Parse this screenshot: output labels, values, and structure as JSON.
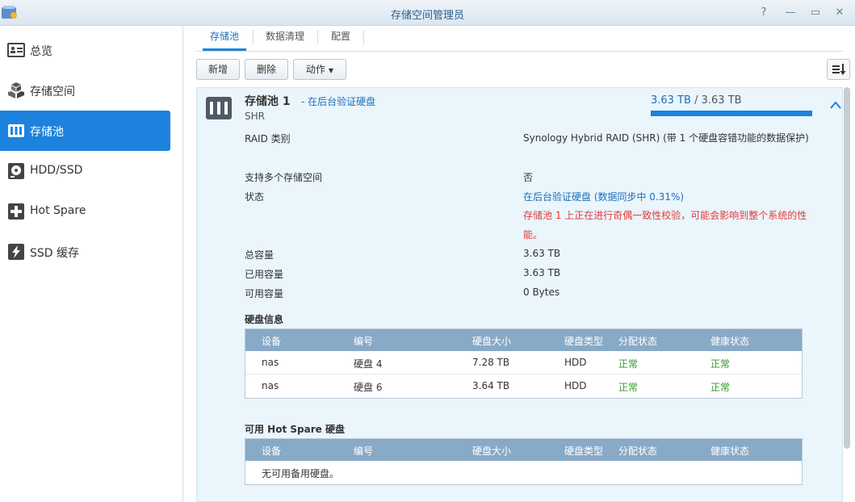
{
  "window": {
    "title": "存储空间管理员",
    "buttons": {
      "help": "?",
      "minimize": "—",
      "maximize": "▭",
      "close": "✕"
    }
  },
  "sidebar": {
    "items": [
      {
        "label": "总览",
        "icon": "overview-icon",
        "active": false
      },
      {
        "label": "存储空间",
        "icon": "volume-icon",
        "active": false
      },
      {
        "label": "存储池",
        "icon": "storage-pool-icon",
        "active": true
      },
      {
        "label": "HDD/SSD",
        "icon": "disk-icon",
        "active": false
      },
      {
        "label": "Hot Spare",
        "icon": "hot-spare-icon",
        "active": false
      },
      {
        "label": "SSD 缓存",
        "icon": "ssd-cache-icon",
        "active": false
      }
    ]
  },
  "tabs": [
    {
      "label": "存储池",
      "active": true
    },
    {
      "label": "数据清理",
      "active": false
    },
    {
      "label": "配置",
      "active": false
    }
  ],
  "toolbar": {
    "create": "新增",
    "delete": "删除",
    "action": "动作",
    "action_caret": "▼"
  },
  "pool": {
    "name": "存储池 1",
    "separator": " - ",
    "status_link": "在后台验证硬盘",
    "type": "SHR",
    "capacity_used": "3.63 TB",
    "capacity_sep": " / ",
    "capacity_total": "3.63 TB",
    "usage_fraction": 1.0,
    "details": {
      "raid_label": "RAID 类别",
      "raid_value": "Synology Hybrid RAID (SHR) (带 1 个硬盘容错功能的数据保护)",
      "multi_label": "支持多个存储空间",
      "multi_value": "否",
      "status_label": "状态",
      "status_value": "在后台验证硬盘 (数据同步中 0.31%)",
      "status_warning": "存储池 1 上正在进行奇偶一致性校验，可能会影响到整个系统的性能。",
      "total_label": "总容量",
      "total_value": "3.63 TB",
      "used_label": "已用容量",
      "used_value": "3.63 TB",
      "free_label": "可用容量",
      "free_value": "0 Bytes"
    }
  },
  "disk_section": {
    "title": "硬盘信息",
    "columns": [
      "设备",
      "编号",
      "硬盘大小",
      "硬盘类型",
      "分配状态",
      "健康状态"
    ],
    "rows": [
      [
        "nas",
        "硬盘 4",
        "7.28 TB",
        "HDD",
        "正常",
        "正常"
      ],
      [
        "nas",
        "硬盘 6",
        "3.64 TB",
        "HDD",
        "正常",
        "正常"
      ]
    ]
  },
  "hotspare_section": {
    "title": "可用 Hot Spare 硬盘",
    "columns": [
      "设备",
      "编号",
      "硬盘大小",
      "硬盘类型",
      "分配状态",
      "健康状态"
    ],
    "empty_text": "无可用备用硬盘。"
  },
  "colors": {
    "accent": "#1d82dd",
    "link": "#1d6fb8",
    "warning": "#e03b3b",
    "healthy": "#2f9b23",
    "grid_header": "#88aac7",
    "panel_bg": "#eaf5fc"
  }
}
